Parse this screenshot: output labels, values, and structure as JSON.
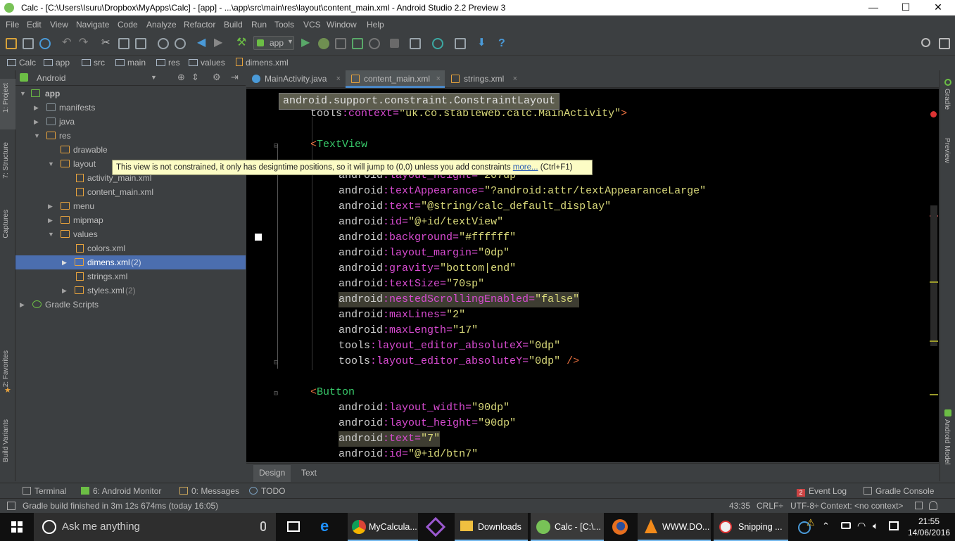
{
  "window": {
    "title": "Calc - [C:\\Users\\Isuru\\Dropbox\\MyApps\\Calc] - [app] - ...\\app\\src\\main\\res\\layout\\content_main.xml - Android Studio 2.2 Preview 3",
    "minimize": "—",
    "maximize": "☐",
    "close": "✕"
  },
  "menu": [
    "File",
    "Edit",
    "View",
    "Navigate",
    "Code",
    "Analyze",
    "Refactor",
    "Build",
    "Run",
    "Tools",
    "VCS",
    "Window",
    "Help"
  ],
  "toolbar": {
    "run_config": "app",
    "help": "?"
  },
  "breadcrumbs": [
    "Calc",
    "app",
    "src",
    "main",
    "res",
    "values",
    "dimens.xml"
  ],
  "project": {
    "view_mode": "Android",
    "tree": [
      {
        "label": "app",
        "count": ""
      },
      {
        "label": "manifests",
        "count": ""
      },
      {
        "label": "java",
        "count": ""
      },
      {
        "label": "res",
        "count": ""
      },
      {
        "label": "drawable",
        "count": ""
      },
      {
        "label": "layout",
        "count": ""
      },
      {
        "label": "activity_main.xml",
        "count": ""
      },
      {
        "label": "content_main.xml",
        "count": ""
      },
      {
        "label": "menu",
        "count": ""
      },
      {
        "label": "mipmap",
        "count": ""
      },
      {
        "label": "values",
        "count": ""
      },
      {
        "label": "colors.xml",
        "count": ""
      },
      {
        "label": "dimens.xml",
        "count": "(2)"
      },
      {
        "label": "strings.xml",
        "count": ""
      },
      {
        "label": "styles.xml",
        "count": "(2)"
      },
      {
        "label": "Gradle Scripts",
        "count": ""
      }
    ]
  },
  "tool_strips": {
    "left": [
      "1: Project",
      "7: Structure",
      "Captures",
      "2: Favorites",
      "Build Variants"
    ],
    "right": [
      "Gradle",
      "Preview",
      "Android Model"
    ]
  },
  "tabs": [
    {
      "label": "MainActivity.java",
      "close": "×"
    },
    {
      "label": "content_main.xml",
      "close": "×"
    },
    {
      "label": "strings.xml",
      "close": "×"
    }
  ],
  "editor": {
    "breadcrumb_popup": "android.support.constraint.ConstraintLayout",
    "tooltip": {
      "text": "This view is not constrained, it only has designtime positions, so it will jump to (0,0) unless you add constraints ",
      "link": "more...",
      "shortcut": " (Ctrl+F1)"
    },
    "lines": [
      {
        "ns": "tools",
        "colon": ":",
        "attr": "context",
        "eq": "=",
        "val": "\"uk.co.stableweb.calc.MainActivity\"",
        "end": ">"
      },
      {
        "open": "<",
        "tag": "TextView"
      },
      {
        "ns": "android",
        "colon": ":",
        "attr": "layout_height",
        "eq": "=",
        "val": "\"207dp\""
      },
      {
        "ns": "android",
        "colon": ":",
        "attr": "textAppearance",
        "eq": "=",
        "val": "\"?android:attr/textAppearanceLarge\""
      },
      {
        "ns": "android",
        "colon": ":",
        "attr": "text",
        "eq": "=",
        "val": "\"@string/calc_default_display\""
      },
      {
        "ns": "android",
        "colon": ":",
        "attr": "id",
        "eq": "=",
        "val": "\"@+id/textView\""
      },
      {
        "ns": "android",
        "colon": ":",
        "attr": "background",
        "eq": "=",
        "val": "\"#ffffff\""
      },
      {
        "ns": "android",
        "colon": ":",
        "attr": "layout_margin",
        "eq": "=",
        "val": "\"0dp\""
      },
      {
        "ns": "android",
        "colon": ":",
        "attr": "gravity",
        "eq": "=",
        "val": "\"bottom|end\""
      },
      {
        "ns": "android",
        "colon": ":",
        "attr": "textSize",
        "eq": "=",
        "val": "\"70sp\""
      },
      {
        "ns": "android",
        "colon": ":",
        "attr": "nestedScrollingEnabled",
        "eq": "=",
        "val": "\"false\""
      },
      {
        "ns": "android",
        "colon": ":",
        "attr": "maxLines",
        "eq": "=",
        "val": "\"2\""
      },
      {
        "ns": "android",
        "colon": ":",
        "attr": "maxLength",
        "eq": "=",
        "val": "\"17\""
      },
      {
        "ns": "tools",
        "colon": ":",
        "attr": "layout_editor_absoluteX",
        "eq": "=",
        "val": "\"0dp\""
      },
      {
        "ns": "tools",
        "colon": ":",
        "attr": "layout_editor_absoluteY",
        "eq": "=",
        "val": "\"0dp\"",
        "end": " />"
      },
      {
        "open": "<",
        "tag": "Button"
      },
      {
        "ns": "android",
        "colon": ":",
        "attr": "layout_width",
        "eq": "=",
        "val": "\"90dp\""
      },
      {
        "ns": "android",
        "colon": ":",
        "attr": "layout_height",
        "eq": "=",
        "val": "\"90dp\""
      },
      {
        "ns": "android",
        "colon": ":",
        "attr": "text",
        "eq": "=",
        "val": "\"7\""
      },
      {
        "ns": "android",
        "colon": ":",
        "attr": "id",
        "eq": "=",
        "val": "\"@+id/btn7\""
      }
    ]
  },
  "bottom_tabs": [
    "Design",
    "Text"
  ],
  "tool_windows": {
    "terminal": "Terminal",
    "android_monitor": "6: Android Monitor",
    "messages": "0: Messages",
    "todo": "TODO",
    "event_log_count": "2",
    "event_log": "Event Log",
    "gradle_console": "Gradle Console"
  },
  "status": {
    "message": "Gradle build finished in 3m 12s 674ms (today 16:05)",
    "position": "43:35",
    "line_sep": "CRLF÷",
    "encoding": "UTF-8÷",
    "context": "Context: <no context>"
  },
  "taskbar": {
    "search": "Ask me anything",
    "apps": [
      "MyCalcula...",
      "Downloads",
      "Calc - [C:\\...",
      "WWW.DO...",
      "Snipping ..."
    ],
    "time": "21:55",
    "date": "14/06/2016"
  }
}
